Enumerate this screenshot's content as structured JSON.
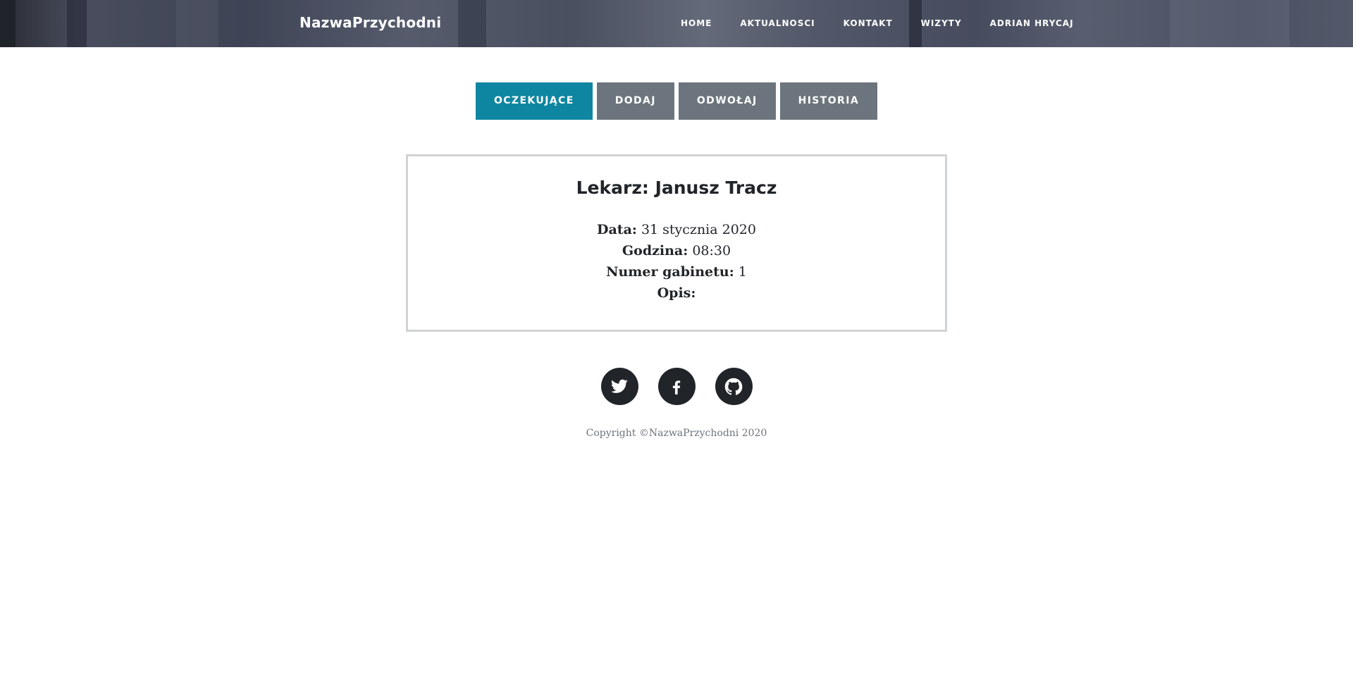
{
  "navbar": {
    "brand": "NazwaPrzychodni",
    "links": [
      "HOME",
      "AKTUALNOSCI",
      "KONTAKT",
      "WIZYTY",
      "ADRIAN HRYCAJ"
    ]
  },
  "tabs": [
    {
      "label": "OCZEKUJĄCE",
      "active": true
    },
    {
      "label": "DODAJ",
      "active": false
    },
    {
      "label": "ODWOŁAJ",
      "active": false
    },
    {
      "label": "HISTORIA",
      "active": false
    }
  ],
  "visit": {
    "doctor_heading": "Lekarz: Janusz Tracz",
    "date_label": "Data:",
    "date_value": "31 stycznia 2020",
    "time_label": "Godzina:",
    "time_value": "08:30",
    "room_label": "Numer gabinetu:",
    "room_value": "1",
    "desc_label": "Opis:",
    "desc_value": ""
  },
  "social": [
    {
      "icon": "twitter-icon"
    },
    {
      "icon": "facebook-icon"
    },
    {
      "icon": "github-icon"
    }
  ],
  "footer": {
    "copyright": "Copyright ©NazwaPrzychodni 2020"
  },
  "colors": {
    "tab_active": "#0f86a1",
    "tab_inactive": "#6c757d",
    "social_bg": "#212529",
    "card_border": "#d0d3d5"
  }
}
